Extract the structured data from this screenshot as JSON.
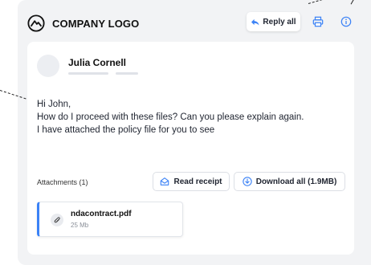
{
  "header": {
    "logo_text": "COMPANY LOGO",
    "reply_all_label": "Reply all"
  },
  "email": {
    "sender_name": "Julia Cornell",
    "body_lines": [
      "Hi John,",
      "How do I proceed with these files? Can you please explain again.",
      "I have attached the policy file for you to see"
    ]
  },
  "attachments": {
    "label": "Attachments (1)",
    "read_receipt_label": "Read receipt",
    "download_all_label": "Download all (1.9MB)",
    "files": [
      {
        "name": "ndacontract.pdf",
        "size": "25 Mb"
      }
    ]
  },
  "colors": {
    "accent": "#3b82f6",
    "background": "#f2f3f5",
    "card": "#ffffff"
  },
  "icons": {
    "logo": "circle-mountain-icon",
    "reply": "reply-icon",
    "print": "print-icon",
    "info": "info-icon",
    "read_receipt": "envelope-open-icon",
    "download": "download-icon",
    "attachment": "paperclip-icon"
  }
}
